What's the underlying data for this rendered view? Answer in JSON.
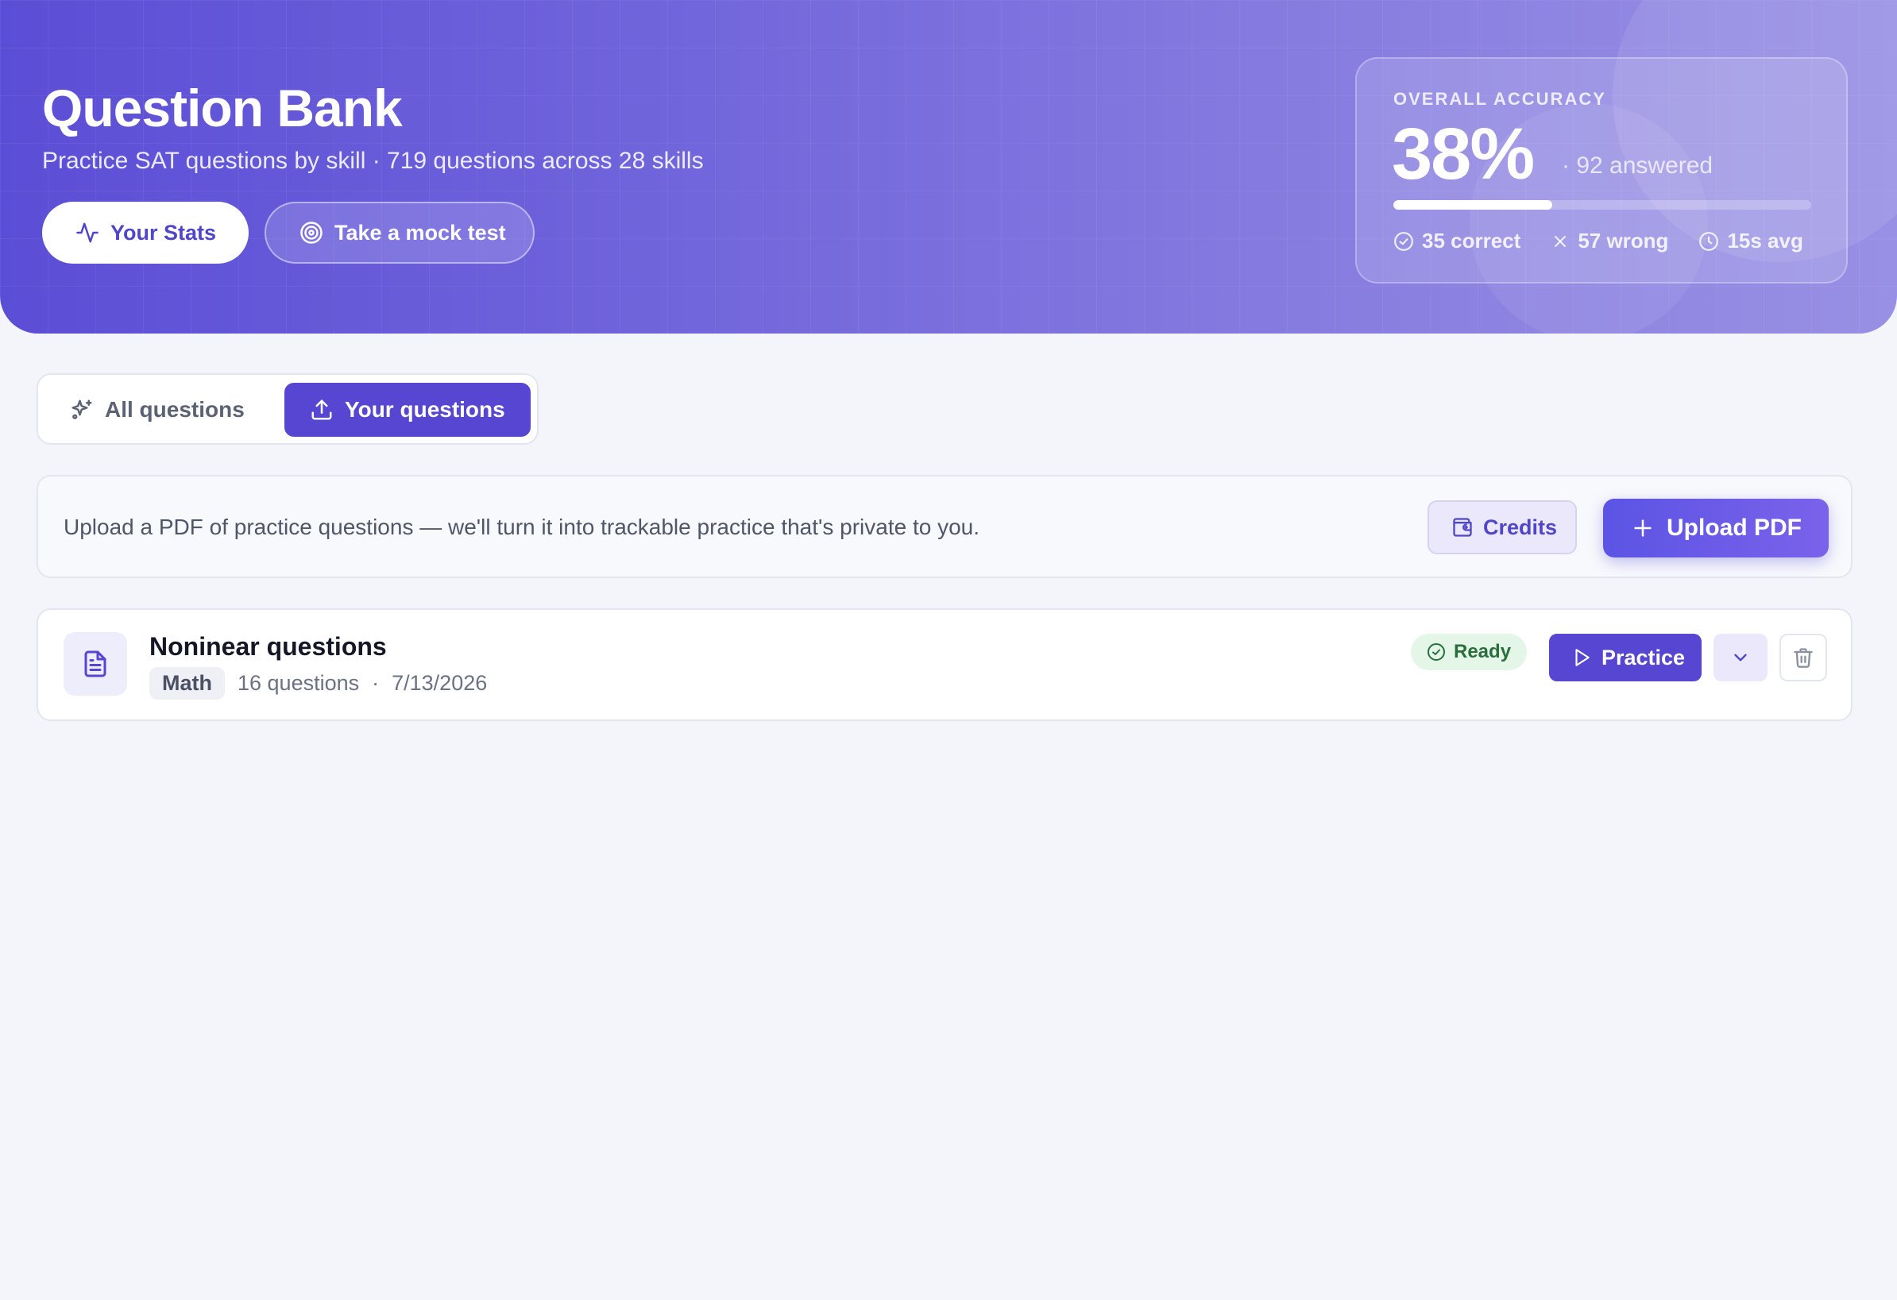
{
  "hero": {
    "title": "Question Bank",
    "subtitle": "Practice SAT questions by skill · 719 questions across 28 skills",
    "stats_button": "Your Stats",
    "mock_button": "Take a mock test"
  },
  "accuracy": {
    "label": "OVERALL ACCURACY",
    "percent_text": "38%",
    "percent_value": 38,
    "answered": "· 92 answered",
    "correct": "35 correct",
    "wrong": "57 wrong",
    "avg": "15s avg"
  },
  "tabs": {
    "all": "All questions",
    "yours": "Your questions",
    "active": "yours"
  },
  "upload": {
    "text": "Upload a PDF of practice questions — we'll turn it into trackable practice that's private to you.",
    "credits_button": "Credits",
    "upload_button": "Upload PDF"
  },
  "documents": [
    {
      "title": "Noninear questions",
      "subject": "Math",
      "count": "16 questions",
      "separator": "·",
      "date": "7/13/2026",
      "status": "Ready",
      "practice_button": "Practice"
    }
  ],
  "colors": {
    "accent": "#5646d2",
    "hero_start": "#5b4ed6",
    "hero_end": "#9890e4",
    "ready_bg": "#e3f6e8",
    "ready_text": "#2a6e3c"
  }
}
